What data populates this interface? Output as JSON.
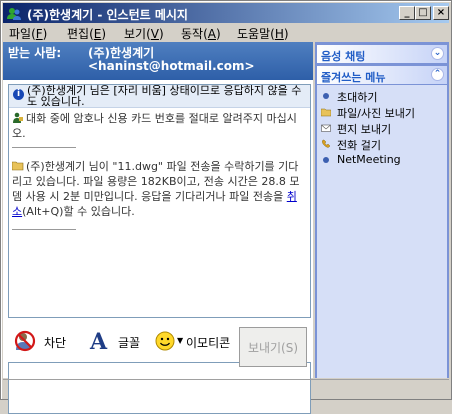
{
  "window": {
    "title": "(주)한생계기 - 인스턴트 메시지",
    "minimize": "_",
    "maximize": "□",
    "close": "×"
  },
  "menu": [
    {
      "label": "파일(",
      "key": "F",
      "end": ")"
    },
    {
      "label": "편집(",
      "key": "E",
      "end": ")"
    },
    {
      "label": "보기(",
      "key": "V",
      "end": ")"
    },
    {
      "label": "동작(",
      "key": "A",
      "end": ")"
    },
    {
      "label": "도움말(",
      "key": "H",
      "end": ")"
    }
  ],
  "recipient": {
    "label": "받는 사람:",
    "name": "(주)한생계기",
    "email": "<haninst@hotmail.com>"
  },
  "status_notice": "(주)한생계기 님은 [자리 비움] 상태이므로 응답하지 않을 수도 있습니다.",
  "messages": {
    "security_warning": "대화 중에 암호나 신용 카드 번호를 절대로 알려주지 마십시오.",
    "transfer_text": "(주)한생계기 님이 \"11.dwg\" 파일 전송을 수락하기를 기다리고 있습니다. 파일 용량은 182KB이고, 전송 시간은 28.8 모뎀 사용 시 2분 미만입니다. 응답을 기다리거나 파일 전송을",
    "cancel_link": "취소",
    "transfer_tail": "(Alt+Q)할 수 있습니다."
  },
  "toolbar": {
    "block_label": "차단",
    "font_label": "글꼴",
    "emoticon_label": "이모티콘"
  },
  "send_button": "보내기(S)",
  "sidebar": {
    "voice_chat": "음성 채팅",
    "favorites": "즐겨쓰는 메뉴",
    "tasks": [
      "초대하기",
      "파일/사진 보내기",
      "편지 보내기",
      "전화 걸기",
      "NetMeeting"
    ]
  },
  "colors": {
    "title_start": "#0a246a",
    "title_end": "#a6caf0",
    "recipient_bar": "#3a6ea5",
    "sidebar_bg": "#7b93d6",
    "link": "#0000cc"
  }
}
